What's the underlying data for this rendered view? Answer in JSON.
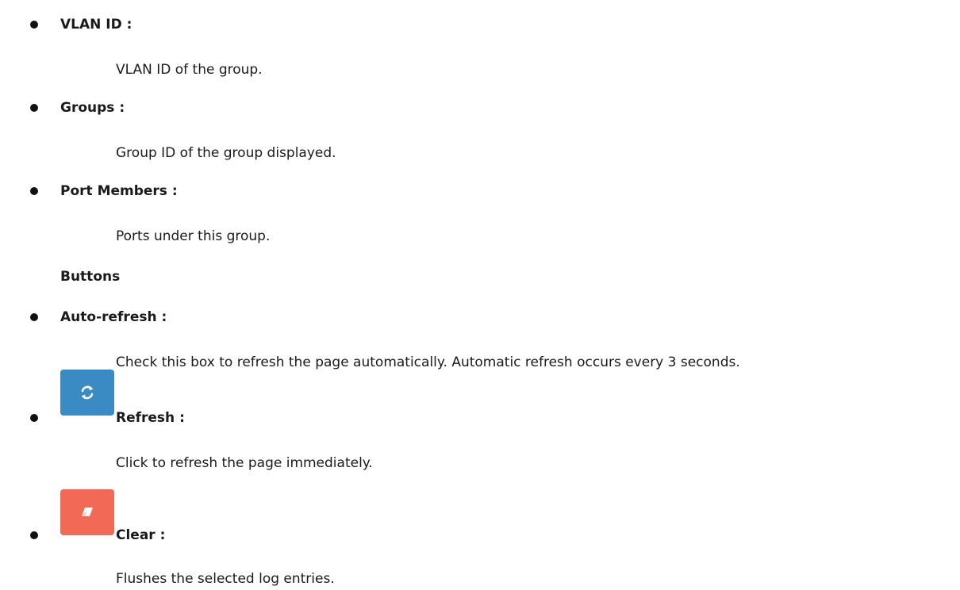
{
  "items": [
    {
      "term": "VLAN ID :",
      "desc": "VLAN ID of the group."
    },
    {
      "term": "Groups :",
      "desc": "Group ID of the group displayed."
    },
    {
      "term": "Port Members :",
      "desc": "Ports under this group."
    }
  ],
  "buttons_heading": "Buttons",
  "button_items": [
    {
      "term": "Auto-refresh :",
      "desc": "Check this box to refresh the page automatically. Automatic refresh occurs every 3 seconds."
    },
    {
      "term": "Refresh :",
      "desc": "Click to refresh the page immediately.",
      "icon": "refresh-icon",
      "color": "#3a8ac4"
    },
    {
      "term": "Clear :",
      "desc": "Flushes the selected log entries.",
      "icon": "eraser-icon",
      "color": "#f26a55"
    }
  ]
}
